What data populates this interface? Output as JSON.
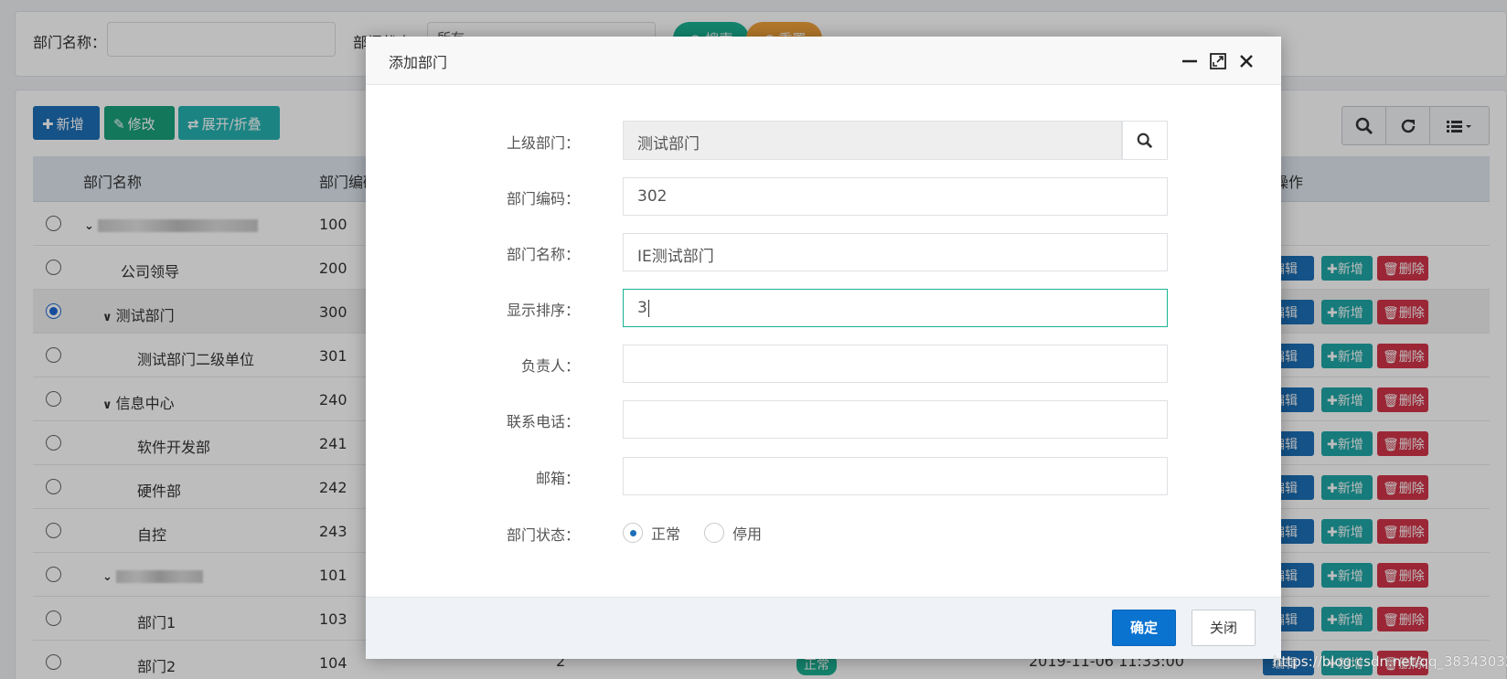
{
  "search": {
    "dept_name_label": "部门名称：",
    "dept_status_label": "部门状态：",
    "dept_status_value": "所有",
    "search_btn": "搜索",
    "reset_btn": "重置"
  },
  "toolbar": {
    "add": "新增",
    "edit": "修改",
    "expand": "展开/折叠"
  },
  "table": {
    "headers": {
      "name": "部门名称",
      "code": "部门编码",
      "actions": "操作"
    },
    "rows": [
      {
        "name": "",
        "code": "100"
      },
      {
        "name": "公司领导",
        "code": "200"
      },
      {
        "name": "测试部门",
        "code": "300"
      },
      {
        "name": "测试部门二级单位",
        "code": "301"
      },
      {
        "name": "信息中心",
        "code": "240"
      },
      {
        "name": "软件开发部",
        "code": "241"
      },
      {
        "name": "硬件部",
        "code": "242"
      },
      {
        "name": "自控",
        "code": "243"
      },
      {
        "name": "",
        "code": "101"
      },
      {
        "name": "部门1",
        "code": "103"
      },
      {
        "name": "部门2",
        "code": "104",
        "order": "2",
        "status": "正常",
        "time": "2019-11-06 11:33:00"
      }
    ],
    "row_actions": {
      "edit": "编辑",
      "add": "新增",
      "delete": "删除"
    }
  },
  "modal": {
    "title": "添加部门",
    "fields": {
      "parent": {
        "label": "上级部门：",
        "value": "测试部门"
      },
      "code": {
        "label": "部门编码：",
        "value": "302"
      },
      "name": {
        "label": "部门名称：",
        "value": "IE测试部门"
      },
      "order": {
        "label": "显示排序：",
        "value": "3"
      },
      "leader": {
        "label": "负责人：",
        "value": ""
      },
      "phone": {
        "label": "联系电话：",
        "value": ""
      },
      "email": {
        "label": "邮箱：",
        "value": ""
      },
      "status": {
        "label": "部门状态：",
        "options": [
          "正常",
          "停用"
        ],
        "selected": "正常"
      }
    },
    "confirm": "确定",
    "close": "关闭"
  },
  "watermark": "https://blog.csdn.net/qq_38343032",
  "colors": {
    "primary": "#0a72cf",
    "teal": "#1fa6a6",
    "danger": "#d2354a",
    "focus": "#1ab394"
  }
}
